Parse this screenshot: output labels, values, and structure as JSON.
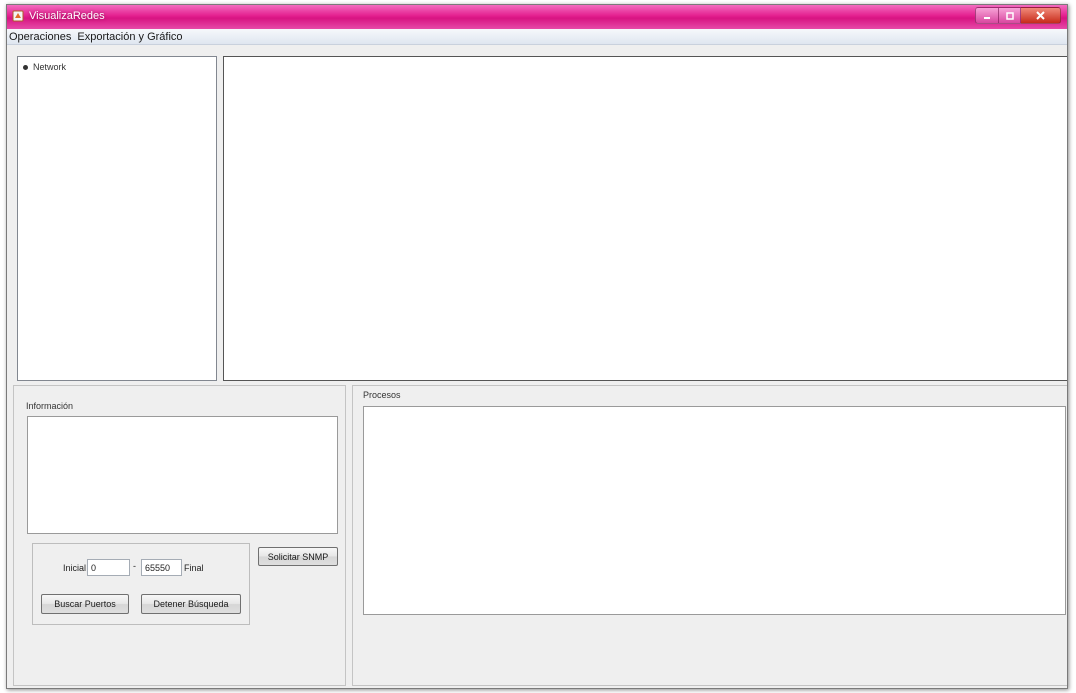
{
  "window": {
    "title": "VisualizaRedes",
    "titlebar_color": "#e0218e"
  },
  "menubar": {
    "items": [
      {
        "label": "Operaciones"
      },
      {
        "label": "Exportación y Gráfico"
      }
    ]
  },
  "tree": {
    "items": [
      {
        "label": "Network"
      }
    ]
  },
  "info": {
    "label": "Información",
    "text": ""
  },
  "ports": {
    "start_label": "Inicial",
    "start_value": "0",
    "separator": "-",
    "end_value": "65550",
    "end_label": "Final",
    "search_button": "Buscar Puertos",
    "stop_button": "Detener Búsqueda"
  },
  "snmp": {
    "button": "Solicitar SNMP"
  },
  "processes": {
    "label": "Procesos",
    "text": ""
  }
}
